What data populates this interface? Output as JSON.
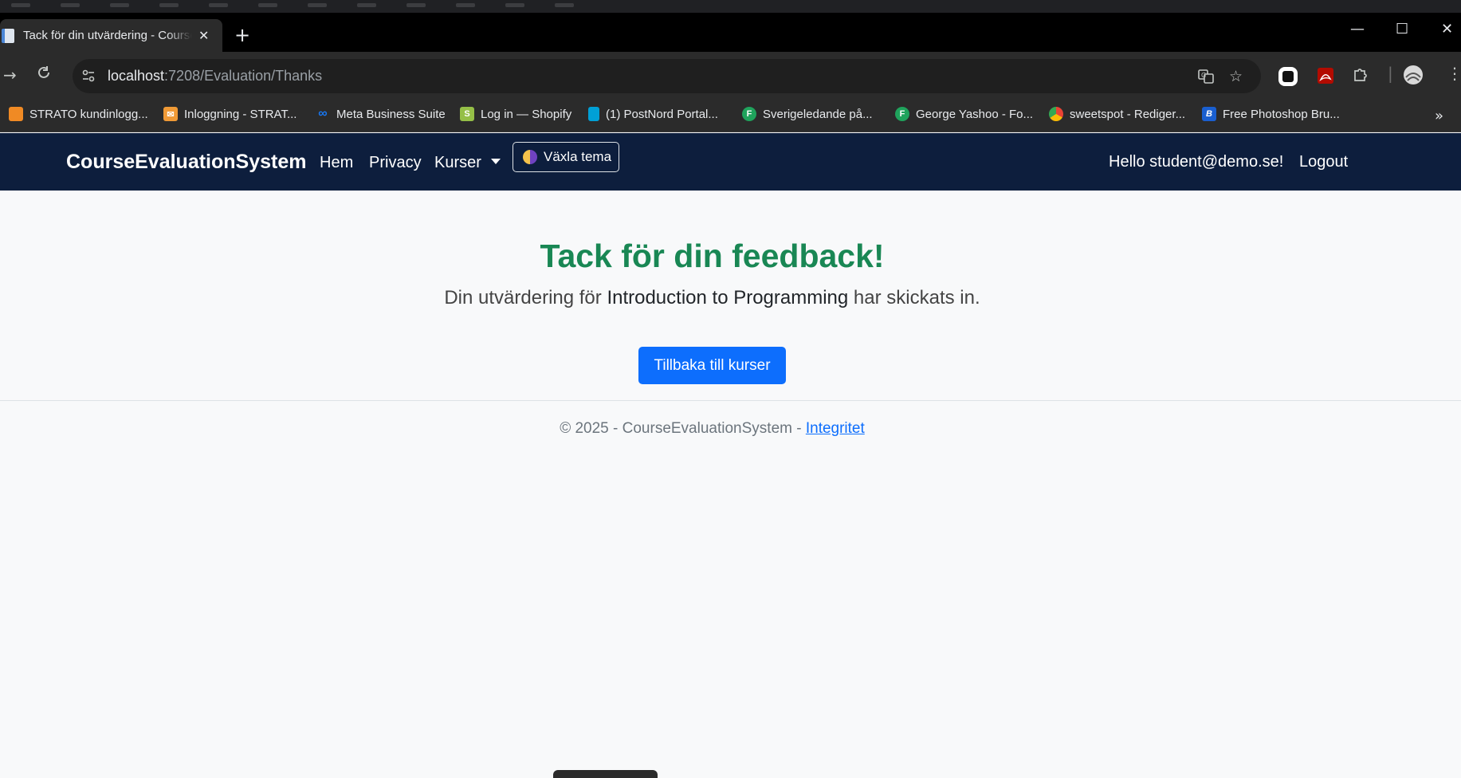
{
  "browser": {
    "tab": {
      "title": "Tack för din utvärdering - CourseEvaluationSystem",
      "close": "✕"
    },
    "new_tab": "+",
    "window": {
      "minimize": "—",
      "maximize": "☐",
      "close": "✕"
    },
    "address": {
      "host": "localhost",
      "path": ":7208/Evaluation/Thanks"
    },
    "bookmarks": [
      {
        "label": "STRATO kundinlogg...",
        "icon": "strato-icon",
        "color": "#f08a24"
      },
      {
        "label": "Inloggning - STRAT...",
        "icon": "mail-icon",
        "color": "#f09a36"
      },
      {
        "label": "Meta Business Suite",
        "icon": "meta-icon",
        "color": "#1877f2"
      },
      {
        "label": "Log in — Shopify",
        "icon": "shopify-icon",
        "color": "#95bf47"
      },
      {
        "label": "(1) PostNord Portal...",
        "icon": "postnord-icon",
        "color": "#00a0d6"
      },
      {
        "label": "Sverigeledande på...",
        "icon": "fortnox-icon",
        "color": "#1fa35c"
      },
      {
        "label": "George Yashoo - Fo...",
        "icon": "fortnox-icon",
        "color": "#1fa35c"
      },
      {
        "label": "sweetspot - Rediger...",
        "icon": "chrome-icon",
        "color": "#ea4335"
      },
      {
        "label": "Free Photoshop Bru...",
        "icon": "brusheezy-icon",
        "color": "#1a5fd0"
      }
    ],
    "bookmarks_more": "»"
  },
  "navbar": {
    "brand": "CourseEvaluationSystem",
    "links": [
      "Hem",
      "Privacy",
      "Kurser"
    ],
    "theme_button": "Växla tema",
    "greeting": "Hello student@demo.se!",
    "logout": "Logout"
  },
  "main": {
    "heading": "Tack för din feedback!",
    "message_prefix": "Din utvärdering för ",
    "course_name": "Introduction to Programming",
    "message_suffix": " har skickats in.",
    "back_button": "Tillbaka till kurser"
  },
  "footer": {
    "text": "© 2025 - CourseEvaluationSystem - ",
    "link": "Integritet"
  },
  "colors": {
    "navbar_bg": "#0d1e3d",
    "heading": "#198754",
    "primary_button": "#0d6efd",
    "page_bg": "#f8f9fa"
  }
}
